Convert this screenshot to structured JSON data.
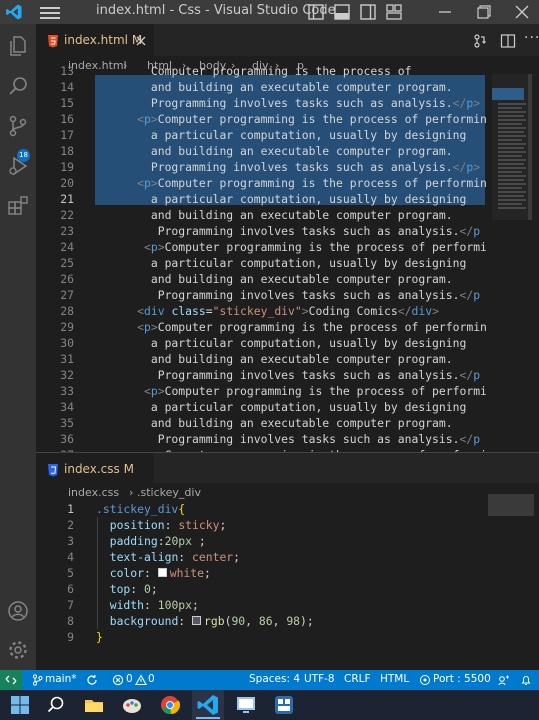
{
  "window": {
    "title": "index.html - Css - Visual Studio Code"
  },
  "activity": {
    "scm_badge": "18"
  },
  "editor1": {
    "tab": {
      "label": "index.html",
      "status": "M"
    },
    "breadcrumb": [
      "index.html",
      "html",
      "body",
      "div",
      "p"
    ],
    "lines": [
      {
        "n": "13",
        "parts": [
          [
            "tx",
            "        "
          ],
          [
            "tx",
            "Computer programming is the process of"
          ]
        ]
      },
      {
        "n": "14",
        "parts": [
          [
            "tx",
            "        and building an executable computer program."
          ]
        ]
      },
      {
        "n": "15",
        "parts": [
          [
            "tx",
            "        Programming involves tasks such as analysis."
          ],
          [
            "tg",
            "</"
          ],
          [
            "tn",
            "p"
          ],
          [
            "tg",
            ">"
          ]
        ]
      },
      {
        "n": "16",
        "parts": [
          [
            "tx",
            "      "
          ],
          [
            "tg",
            "<"
          ],
          [
            "tn",
            "p"
          ],
          [
            "tg",
            ">"
          ],
          [
            "tx",
            "Computer programming is the process of performing"
          ]
        ]
      },
      {
        "n": "17",
        "parts": [
          [
            "tx",
            "        a particular computation, usually by designing"
          ]
        ]
      },
      {
        "n": "18",
        "parts": [
          [
            "tx",
            "        and building an executable computer program."
          ]
        ]
      },
      {
        "n": "19",
        "parts": [
          [
            "tx",
            "        Programming involves tasks such as analysis."
          ],
          [
            "tg",
            "</"
          ],
          [
            "tn",
            "p"
          ],
          [
            "tg",
            ">"
          ]
        ]
      },
      {
        "n": "20",
        "parts": [
          [
            "tx",
            "      "
          ],
          [
            "tg",
            "<"
          ],
          [
            "tn",
            "p"
          ],
          [
            "tg",
            ">"
          ],
          [
            "tx",
            "Computer programming is the process of performing"
          ]
        ]
      },
      {
        "n": "21",
        "parts": [
          [
            "tx",
            "        a particular computation, usually by designing"
          ]
        ]
      },
      {
        "n": "22",
        "parts": [
          [
            "tx",
            "        and building an executable computer program."
          ]
        ]
      },
      {
        "n": "23",
        "parts": [
          [
            "tx",
            "         Programming involves tasks such as analysis."
          ],
          [
            "tg",
            "</"
          ],
          [
            "tn",
            "p"
          ]
        ]
      },
      {
        "n": "24",
        "parts": [
          [
            "tx",
            "       "
          ],
          [
            "tg",
            "<"
          ],
          [
            "tn",
            "p"
          ],
          [
            "tg",
            ">"
          ],
          [
            "tx",
            "Computer programming is the process of performing"
          ]
        ]
      },
      {
        "n": "25",
        "parts": [
          [
            "tx",
            "        a particular computation, usually by designing"
          ]
        ]
      },
      {
        "n": "26",
        "parts": [
          [
            "tx",
            "        and building an executable computer program."
          ]
        ]
      },
      {
        "n": "27",
        "parts": [
          [
            "tx",
            "         Programming involves tasks such as analysis."
          ],
          [
            "tg",
            "</"
          ],
          [
            "tn",
            "p"
          ]
        ]
      },
      {
        "n": "28",
        "parts": [
          [
            "tx",
            "      "
          ],
          [
            "tg",
            "<"
          ],
          [
            "tn",
            "div"
          ],
          [
            "tx",
            " "
          ],
          [
            "at",
            "class"
          ],
          [
            "tx",
            "="
          ],
          [
            "st",
            "\"stickey_div\""
          ],
          [
            "tg",
            ">"
          ],
          [
            "tx",
            "Coding Comics"
          ],
          [
            "tg",
            "</"
          ],
          [
            "tn",
            "div"
          ],
          [
            "tg",
            ">"
          ]
        ]
      },
      {
        "n": "29",
        "parts": [
          [
            "tx",
            "      "
          ],
          [
            "tg",
            "<"
          ],
          [
            "tn",
            "p"
          ],
          [
            "tg",
            ">"
          ],
          [
            "tx",
            "Computer programming is the process of performing"
          ]
        ]
      },
      {
        "n": "30",
        "parts": [
          [
            "tx",
            "        a particular computation, usually by designing"
          ]
        ]
      },
      {
        "n": "31",
        "parts": [
          [
            "tx",
            "        and building an executable computer program."
          ]
        ]
      },
      {
        "n": "32",
        "parts": [
          [
            "tx",
            "         Programming involves tasks such as analysis."
          ],
          [
            "tg",
            "</"
          ],
          [
            "tn",
            "p"
          ]
        ]
      },
      {
        "n": "33",
        "parts": [
          [
            "tx",
            "       "
          ],
          [
            "tg",
            "<"
          ],
          [
            "tn",
            "p"
          ],
          [
            "tg",
            ">"
          ],
          [
            "tx",
            "Computer programming is the process of performing"
          ]
        ]
      },
      {
        "n": "34",
        "parts": [
          [
            "tx",
            "        a particular computation, usually by designing"
          ]
        ]
      },
      {
        "n": "35",
        "parts": [
          [
            "tx",
            "        and building an executable computer program."
          ]
        ]
      },
      {
        "n": "36",
        "parts": [
          [
            "tx",
            "         Programming involves tasks such as analysis."
          ],
          [
            "tg",
            "</"
          ],
          [
            "tn",
            "p"
          ]
        ]
      },
      {
        "n": "37",
        "parts": [
          [
            "tx",
            "       "
          ],
          [
            "tg",
            "<"
          ],
          [
            "tn",
            "p"
          ],
          [
            "tg",
            ">"
          ],
          [
            "tx",
            "Computer programming is the process of performing"
          ]
        ]
      }
    ]
  },
  "editor2": {
    "tab": {
      "label": "index.css",
      "status": "M"
    },
    "breadcrumb": [
      "index.css",
      ".stickey_div"
    ],
    "lines": [
      {
        "n": "1",
        "parts": [
          [
            "sel",
            ".stickey_div"
          ],
          [
            "cb",
            "{"
          ]
        ]
      },
      {
        "n": "2",
        "parts": [
          [
            "tx",
            "  "
          ],
          [
            "pr",
            "position"
          ],
          [
            "pu",
            ": "
          ],
          [
            "vl",
            "sticky"
          ],
          [
            "pu",
            ";"
          ]
        ]
      },
      {
        "n": "3",
        "parts": [
          [
            "tx",
            "  "
          ],
          [
            "pr",
            "padding"
          ],
          [
            "pu",
            ":"
          ],
          [
            "nm",
            "20px"
          ],
          [
            "pu",
            " ;"
          ]
        ]
      },
      {
        "n": "4",
        "parts": [
          [
            "tx",
            "  "
          ],
          [
            "pr",
            "text-align"
          ],
          [
            "pu",
            ": "
          ],
          [
            "vl",
            "center"
          ],
          [
            "pu",
            ";"
          ]
        ]
      },
      {
        "n": "5",
        "parts": [
          [
            "tx",
            "  "
          ],
          [
            "pr",
            "color"
          ],
          [
            "pu",
            ": "
          ],
          [
            "sw",
            "#ffffff"
          ],
          [
            "vl",
            "white"
          ],
          [
            "pu",
            ";"
          ]
        ]
      },
      {
        "n": "6",
        "parts": [
          [
            "tx",
            "  "
          ],
          [
            "pr",
            "top"
          ],
          [
            "pu",
            ": "
          ],
          [
            "nm",
            "0"
          ],
          [
            "pu",
            ";"
          ]
        ]
      },
      {
        "n": "7",
        "parts": [
          [
            "tx",
            "  "
          ],
          [
            "pr",
            "width"
          ],
          [
            "pu",
            ": "
          ],
          [
            "nm",
            "100px"
          ],
          [
            "pu",
            ";"
          ]
        ]
      },
      {
        "n": "8",
        "parts": [
          [
            "tx",
            "  "
          ],
          [
            "pr",
            "background"
          ],
          [
            "pu",
            ": "
          ],
          [
            "sw",
            "#5a5662"
          ],
          [
            "fn",
            "rgb"
          ],
          [
            "pu",
            "("
          ],
          [
            "nm",
            "90"
          ],
          [
            "pu",
            ", "
          ],
          [
            "nm",
            "86"
          ],
          [
            "pu",
            ", "
          ],
          [
            "nm",
            "98"
          ],
          [
            "pu",
            ");"
          ]
        ]
      },
      {
        "n": "9",
        "parts": [
          [
            "cb",
            "}"
          ]
        ]
      }
    ]
  },
  "status": {
    "branch": "main*",
    "errors": "0",
    "warnings": "0",
    "spaces": "Spaces: 4",
    "encoding": "UTF-8",
    "eol": "CRLF",
    "language": "HTML",
    "port": "Port : 5500"
  },
  "colors": {
    "accent": "#007acc",
    "selection": "#264f78",
    "swatch_white": "#ffffff",
    "swatch_bg": "#5a5662"
  }
}
